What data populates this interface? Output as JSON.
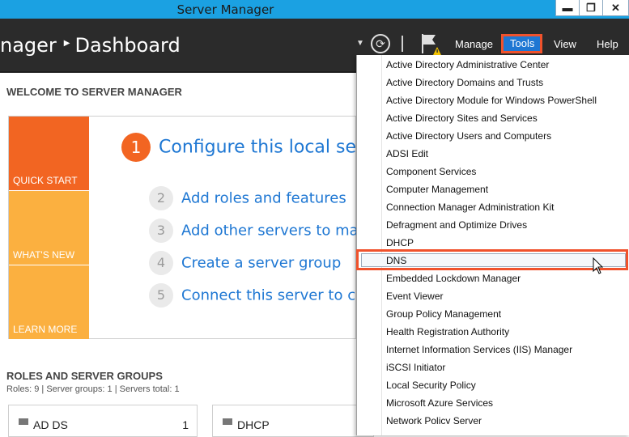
{
  "window": {
    "title": "Server Manager"
  },
  "window_controls": {
    "minimize": "▬",
    "restore": "❐",
    "close": "✕"
  },
  "header": {
    "breadcrumb_app": "nager",
    "breadcrumb_sep": "▶",
    "breadcrumb_page": "Dashboard",
    "menu": {
      "manage": "Manage",
      "tools": "Tools",
      "view": "View",
      "help": "Help"
    }
  },
  "welcome": {
    "title": "WELCOME TO SERVER MANAGER",
    "tiles": {
      "quick_start": "QUICK START",
      "whats_new": "WHAT'S NEW",
      "learn_more": "LEARN MORE"
    },
    "steps": [
      {
        "num": "1",
        "text": "Configure this local serve"
      },
      {
        "num": "2",
        "text": "Add roles and features"
      },
      {
        "num": "3",
        "text": "Add other servers to manag"
      },
      {
        "num": "4",
        "text": "Create a server group"
      },
      {
        "num": "5",
        "text": "Connect this server to clouc"
      }
    ]
  },
  "roles": {
    "title": "ROLES AND SERVER GROUPS",
    "summary": "Roles: 9   |   Server groups: 1   |   Servers total: 1",
    "cards": [
      {
        "label": "AD DS",
        "count": "1"
      },
      {
        "label": "DHCP",
        "count": ""
      }
    ]
  },
  "tools_menu": {
    "items": [
      "Active Directory Administrative Center",
      "Active Directory Domains and Trusts",
      "Active Directory Module for Windows PowerShell",
      "Active Directory Sites and Services",
      "Active Directory Users and Computers",
      "ADSI Edit",
      "Component Services",
      "Computer Management",
      "Connection Manager Administration Kit",
      "Defragment and Optimize Drives",
      "DHCP",
      "DNS",
      "Embedded Lockdown Manager",
      "Event Viewer",
      "Group Policy Management",
      "Health Registration Authority",
      "Internet Information Services (IIS) Manager",
      "iSCSI Initiator",
      "Local Security Policy",
      "Microsoft Azure Services",
      "Network Policy Server"
    ],
    "highlighted": "DNS"
  },
  "colors": {
    "accent": "#1e77d3",
    "titlebar": "#1ba1e2",
    "header": "#2b2b2b",
    "quick_start": "#f26522",
    "tile_light": "#fbb040",
    "highlight_border": "#f0522c"
  }
}
